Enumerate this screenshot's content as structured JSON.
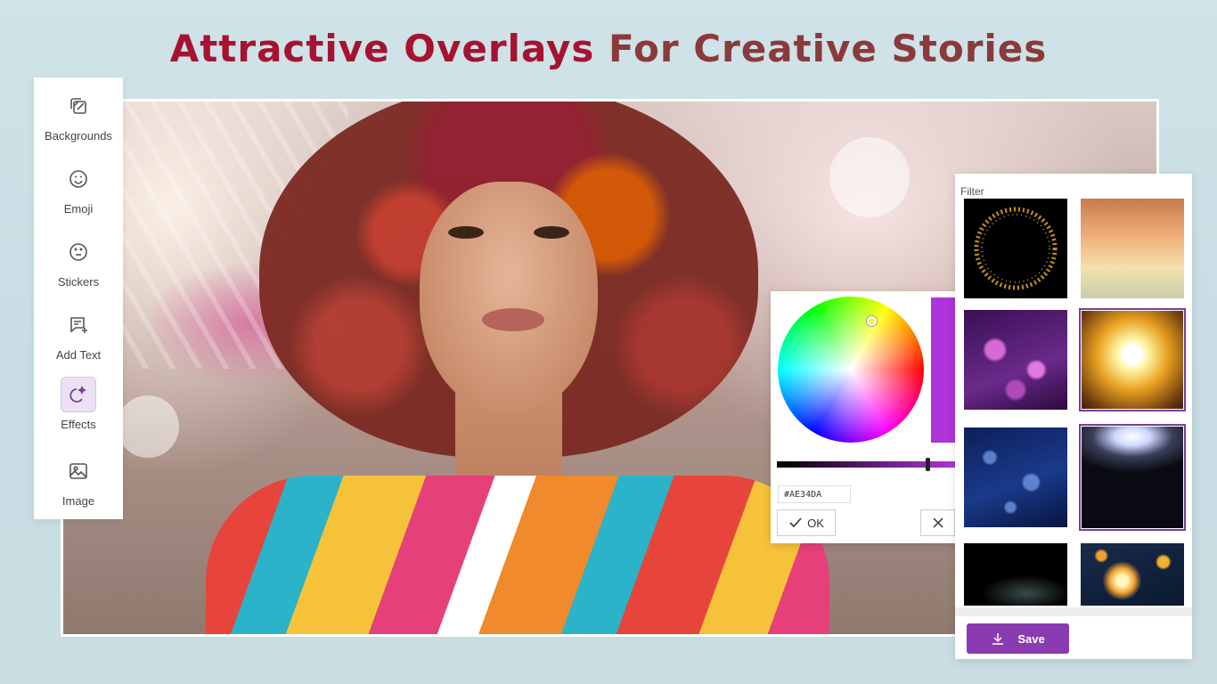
{
  "headline": {
    "accent": "Attractive Overlays",
    "rest": "For Creative Stories"
  },
  "sidebar": {
    "items": [
      {
        "label": "Backgrounds",
        "icon": "backgrounds-icon",
        "active": false
      },
      {
        "label": "Emoji",
        "icon": "emoji-icon",
        "active": false
      },
      {
        "label": "Stickers",
        "icon": "sticker-icon",
        "active": false
      },
      {
        "label": "Add Text",
        "icon": "add-text-icon",
        "active": false
      },
      {
        "label": "Effects",
        "icon": "effects-icon",
        "active": true
      },
      {
        "label": "Image",
        "icon": "image-icon",
        "active": false
      }
    ]
  },
  "color_picker": {
    "hex_value": "#AE34DA",
    "selected_color": "#ae34da",
    "brightness_level": 0.85,
    "ok_label": "OK"
  },
  "filter_panel": {
    "title": "Filter",
    "thumbnails": [
      {
        "name": "gold-sparkle-ring",
        "selected": false
      },
      {
        "name": "sunset-clouds",
        "selected": false
      },
      {
        "name": "purple-bokeh",
        "selected": false
      },
      {
        "name": "golden-light-burst",
        "selected": true
      },
      {
        "name": "blue-bubbles",
        "selected": false
      },
      {
        "name": "top-light-glow",
        "selected": true
      },
      {
        "name": "dark-smoke",
        "selected": false
      },
      {
        "name": "orange-fireworks",
        "selected": false
      }
    ],
    "save_label": "Save"
  },
  "colors": {
    "accent_purple": "#8a3bb0",
    "headline_red": "#a51331",
    "headline_brown": "#8a3a3a"
  }
}
